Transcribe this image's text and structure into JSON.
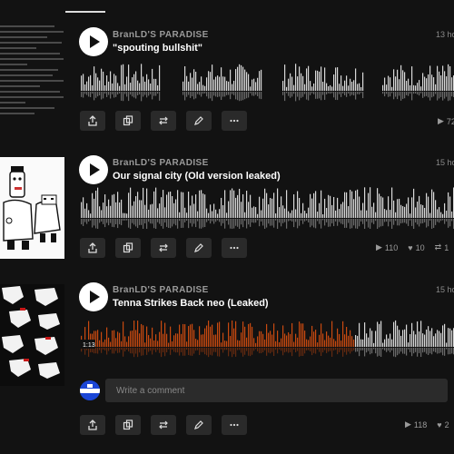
{
  "tracks": [
    {
      "artist": "BranLD'S PARADISE",
      "title": "\"spouting bullshit\"",
      "time": "13 ho",
      "plays": "72",
      "likes": "",
      "reposts": "",
      "progress": 0,
      "position_label": ""
    },
    {
      "artist": "BranLD'S PARADISE",
      "title": "Our signal city (Old version leaked)",
      "time": "15 ho",
      "plays": "110",
      "likes": "10",
      "reposts": "1"
    },
    {
      "artist": "BranLD'S PARADISE",
      "title": "Tenna Strikes Back neo (Leaked)",
      "time": "15 ho",
      "plays": "118",
      "likes": "2",
      "reposts": "",
      "progress": 0.73,
      "position_label": "1:13"
    }
  ],
  "comment": {
    "placeholder": "Write a comment"
  },
  "actions": [
    "share-icon",
    "copy-icon",
    "repost-icon",
    "edit-icon",
    "more-icon"
  ],
  "colors": {
    "accent": "#c84a10",
    "wave": "#d8d8d8",
    "wave_played": "#c84a10",
    "button_bg": "#2a2a2a"
  }
}
